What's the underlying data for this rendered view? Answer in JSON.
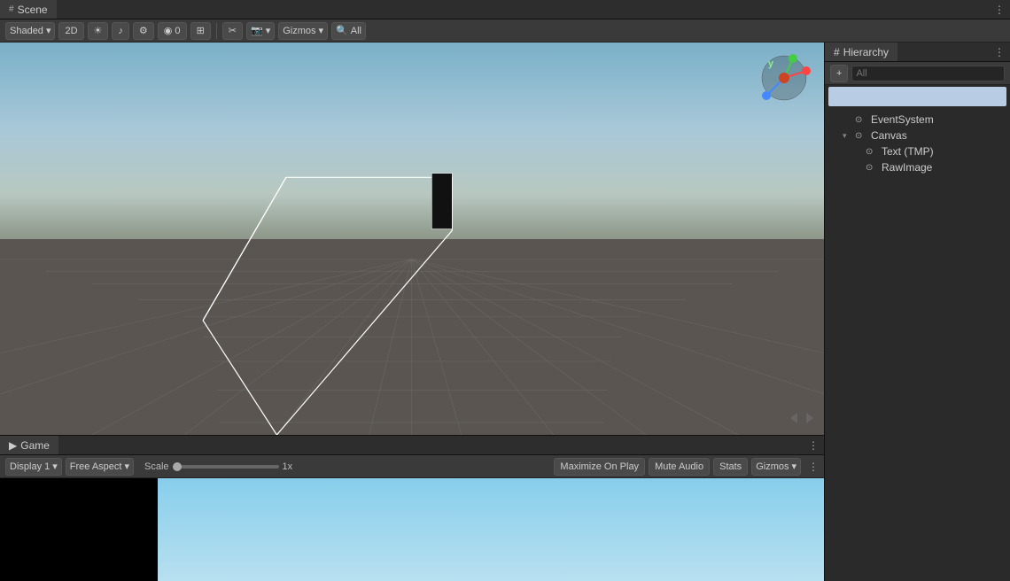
{
  "scene_tab": {
    "label": "Scene",
    "icon": "#"
  },
  "game_tab": {
    "label": "Game",
    "icon": "▶"
  },
  "hierarchy_tab": {
    "label": "Hierarchy",
    "icon": "#"
  },
  "scene_toolbar": {
    "shading_label": "Shaded",
    "mode_2d": "2D",
    "gizmos_label": "Gizmos",
    "all_label": "All"
  },
  "game_toolbar": {
    "display_label": "Display 1",
    "aspect_label": "Free Aspect",
    "scale_label": "Scale",
    "scale_value": "1x",
    "maximize_label": "Maximize On Play",
    "mute_label": "Mute Audio",
    "stats_label": "Stats",
    "gizmos_label": "Gizmos"
  },
  "hierarchy": {
    "search_placeholder": "All",
    "items": [
      {
        "label": "EventSystem",
        "indent": 1,
        "icon": "⊙",
        "arrow": ""
      },
      {
        "label": "Canvas",
        "indent": 1,
        "icon": "⊙",
        "arrow": "▾"
      },
      {
        "label": "Text (TMP)",
        "indent": 2,
        "icon": "⊙",
        "arrow": ""
      },
      {
        "label": "RawImage",
        "indent": 2,
        "icon": "⊙",
        "arrow": ""
      }
    ]
  },
  "axis_label": "y",
  "nav_hint": "◀▶",
  "plus_btn": "+",
  "menu_btn": "⋮"
}
